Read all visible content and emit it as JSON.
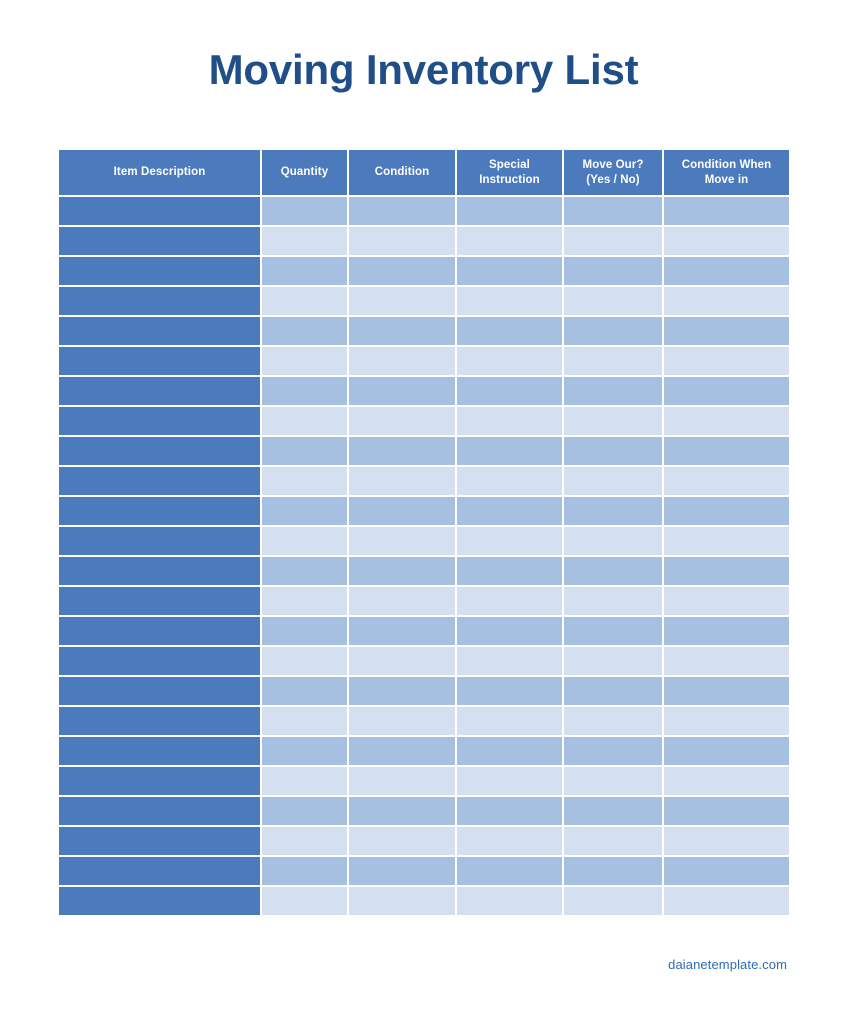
{
  "document": {
    "title": "Moving Inventory List",
    "background_color": "#FFFFFF",
    "title_color": "#1F4E88"
  },
  "table": {
    "header_bg": "#4C7BBD",
    "header_text_color": "#FFFFFF",
    "item_column_bg": "#4C7BBD",
    "row_alt_dark_bg": "#A5C0E0",
    "row_alt_light_bg": "#D4E0F0",
    "columns": [
      {
        "key": "item_description",
        "label": "Item Description"
      },
      {
        "key": "quantity",
        "label": "Quantity"
      },
      {
        "key": "condition",
        "label": "Condition"
      },
      {
        "key": "special_instruction",
        "label": "Special\nInstruction"
      },
      {
        "key": "move_our",
        "label": "Move Our?\n(Yes / No)"
      },
      {
        "key": "condition_when_move_in",
        "label": "Condition When\nMove in"
      }
    ],
    "header_labels": {
      "item_description": "Item Description",
      "quantity": "Quantity",
      "condition": "Condition",
      "special_instruction_line1": "Special",
      "special_instruction_line2": "Instruction",
      "move_our_line1": "Move Our?",
      "move_our_line2": "(Yes / No)",
      "condition_when_move_in_line1": "Condition When",
      "condition_when_move_in_line2": "Move in"
    },
    "row_count": 24,
    "rows": [
      {
        "item_description": "",
        "quantity": "",
        "condition": "",
        "special_instruction": "",
        "move_our": "",
        "condition_when_move_in": ""
      },
      {
        "item_description": "",
        "quantity": "",
        "condition": "",
        "special_instruction": "",
        "move_our": "",
        "condition_when_move_in": ""
      },
      {
        "item_description": "",
        "quantity": "",
        "condition": "",
        "special_instruction": "",
        "move_our": "",
        "condition_when_move_in": ""
      },
      {
        "item_description": "",
        "quantity": "",
        "condition": "",
        "special_instruction": "",
        "move_our": "",
        "condition_when_move_in": ""
      },
      {
        "item_description": "",
        "quantity": "",
        "condition": "",
        "special_instruction": "",
        "move_our": "",
        "condition_when_move_in": ""
      },
      {
        "item_description": "",
        "quantity": "",
        "condition": "",
        "special_instruction": "",
        "move_our": "",
        "condition_when_move_in": ""
      },
      {
        "item_description": "",
        "quantity": "",
        "condition": "",
        "special_instruction": "",
        "move_our": "",
        "condition_when_move_in": ""
      },
      {
        "item_description": "",
        "quantity": "",
        "condition": "",
        "special_instruction": "",
        "move_our": "",
        "condition_when_move_in": ""
      },
      {
        "item_description": "",
        "quantity": "",
        "condition": "",
        "special_instruction": "",
        "move_our": "",
        "condition_when_move_in": ""
      },
      {
        "item_description": "",
        "quantity": "",
        "condition": "",
        "special_instruction": "",
        "move_our": "",
        "condition_when_move_in": ""
      },
      {
        "item_description": "",
        "quantity": "",
        "condition": "",
        "special_instruction": "",
        "move_our": "",
        "condition_when_move_in": ""
      },
      {
        "item_description": "",
        "quantity": "",
        "condition": "",
        "special_instruction": "",
        "move_our": "",
        "condition_when_move_in": ""
      },
      {
        "item_description": "",
        "quantity": "",
        "condition": "",
        "special_instruction": "",
        "move_our": "",
        "condition_when_move_in": ""
      },
      {
        "item_description": "",
        "quantity": "",
        "condition": "",
        "special_instruction": "",
        "move_our": "",
        "condition_when_move_in": ""
      },
      {
        "item_description": "",
        "quantity": "",
        "condition": "",
        "special_instruction": "",
        "move_our": "",
        "condition_when_move_in": ""
      },
      {
        "item_description": "",
        "quantity": "",
        "condition": "",
        "special_instruction": "",
        "move_our": "",
        "condition_when_move_in": ""
      },
      {
        "item_description": "",
        "quantity": "",
        "condition": "",
        "special_instruction": "",
        "move_our": "",
        "condition_when_move_in": ""
      },
      {
        "item_description": "",
        "quantity": "",
        "condition": "",
        "special_instruction": "",
        "move_our": "",
        "condition_when_move_in": ""
      },
      {
        "item_description": "",
        "quantity": "",
        "condition": "",
        "special_instruction": "",
        "move_our": "",
        "condition_when_move_in": ""
      },
      {
        "item_description": "",
        "quantity": "",
        "condition": "",
        "special_instruction": "",
        "move_our": "",
        "condition_when_move_in": ""
      },
      {
        "item_description": "",
        "quantity": "",
        "condition": "",
        "special_instruction": "",
        "move_our": "",
        "condition_when_move_in": ""
      },
      {
        "item_description": "",
        "quantity": "",
        "condition": "",
        "special_instruction": "",
        "move_our": "",
        "condition_when_move_in": ""
      },
      {
        "item_description": "",
        "quantity": "",
        "condition": "",
        "special_instruction": "",
        "move_our": "",
        "condition_when_move_in": ""
      },
      {
        "item_description": "",
        "quantity": "",
        "condition": "",
        "special_instruction": "",
        "move_our": "",
        "condition_when_move_in": ""
      }
    ]
  },
  "footer": {
    "credit": "daianetemplate.com",
    "color": "#2E6BB5"
  }
}
